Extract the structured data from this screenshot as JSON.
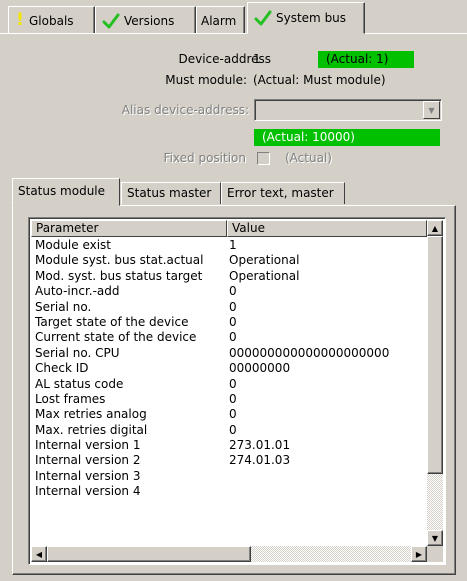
{
  "top_tabs": [
    {
      "label": "Globals",
      "icon": "exclamation-icon"
    },
    {
      "label": "Versions",
      "icon": "check-icon"
    },
    {
      "label": "Alarm",
      "icon": ""
    },
    {
      "label": "System bus",
      "icon": "check-icon",
      "active": true
    }
  ],
  "form": {
    "device_address_label": "Device-address",
    "device_address_value": "1",
    "device_address_actual": "(Actual: 1)",
    "must_module_label": "Must module:",
    "must_module_value": "(Actual: Must module)",
    "alias_label": "Alias device-address:",
    "alias_value": "",
    "alias_actual": "(Actual: 10000)",
    "fixed_position_label": "Fixed position",
    "fixed_position_actual": "(Actual)"
  },
  "sub_tabs": [
    {
      "label": "Status module",
      "active": true
    },
    {
      "label": "Status master"
    },
    {
      "label": "Error text, master"
    }
  ],
  "table": {
    "columns": [
      "Parameter",
      "Value"
    ],
    "rows": [
      [
        "Module exist",
        "1"
      ],
      [
        "Module syst. bus stat.actual",
        "Operational"
      ],
      [
        "Mod. syst. bus status target",
        "Operational"
      ],
      [
        "Auto-incr.-add",
        "0"
      ],
      [
        "Serial no.",
        "0"
      ],
      [
        "Target state of the device",
        "0"
      ],
      [
        "Current state of the device",
        "0"
      ],
      [
        "Serial no. CPU",
        "000000000000000000000"
      ],
      [
        "Check ID",
        "00000000"
      ],
      [
        "AL status code",
        "0"
      ],
      [
        "Lost frames",
        "0"
      ],
      [
        "Max retries analog",
        "0"
      ],
      [
        "Max. retries digital",
        "0"
      ],
      [
        "Internal version 1",
        "273.01.01"
      ],
      [
        "Internal version 2",
        "274.01.03"
      ],
      [
        "Internal version 3",
        ""
      ],
      [
        "Internal version 4",
        ""
      ]
    ]
  },
  "colors": {
    "window": "#d4d0c8",
    "actual_highlight": "#00c000",
    "check_icon": "#22c022",
    "exclamation_icon": "#f2e600"
  }
}
